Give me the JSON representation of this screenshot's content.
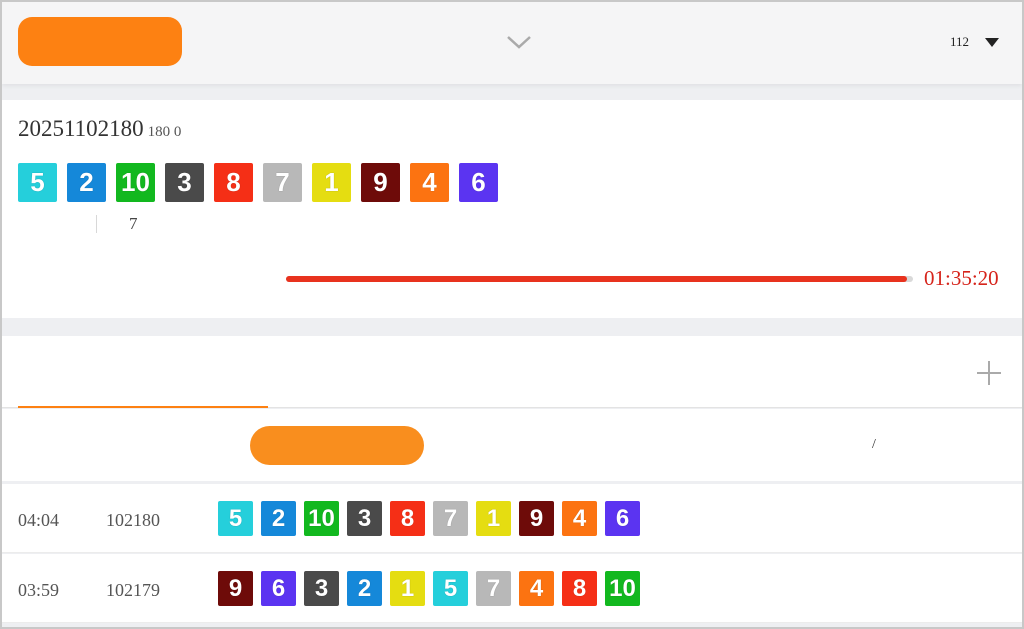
{
  "header": {
    "back_label": "",
    "game_title": "",
    "period_label": "112"
  },
  "latest": {
    "issue": "20251102180",
    "sub": "180 0",
    "balls": [
      5,
      2,
      10,
      3,
      8,
      7,
      1,
      9,
      4,
      6
    ],
    "stats": [
      "",
      "",
      "",
      "",
      ""
    ],
    "sum_label": "",
    "sum_value": "7",
    "sum_extra": [
      "",
      ""
    ]
  },
  "countdown": {
    "label": "",
    "time": "01:35:20",
    "progress_fraction": 0.99
  },
  "tabs": [
    {
      "label": "",
      "active": true
    },
    {
      "label": "",
      "active": false
    },
    {
      "label": "",
      "active": false
    }
  ],
  "table_headers": {
    "time": "",
    "issue": "",
    "numbers": "",
    "col4": "",
    "col5": "",
    "col6": "/"
  },
  "rows": [
    {
      "time": "04:04",
      "issue": "102180",
      "balls": [
        5,
        2,
        10,
        3,
        8,
        7,
        1,
        9,
        4,
        6
      ]
    },
    {
      "time": "03:59",
      "issue": "102179",
      "balls": [
        9,
        6,
        3,
        2,
        1,
        5,
        7,
        4,
        8,
        10
      ]
    }
  ],
  "ball_colors": {
    "1": "#e5dd11",
    "2": "#1588d9",
    "3": "#4a4a4a",
    "4": "#fc7311",
    "5": "#25cfdb",
    "6": "#5b34f1",
    "7": "#b8b8b8",
    "8": "#f52f16",
    "9": "#6e0b09",
    "10": "#12b81f"
  },
  "colors": {
    "accent": "#fd8112",
    "countdown": "#d6241b"
  }
}
